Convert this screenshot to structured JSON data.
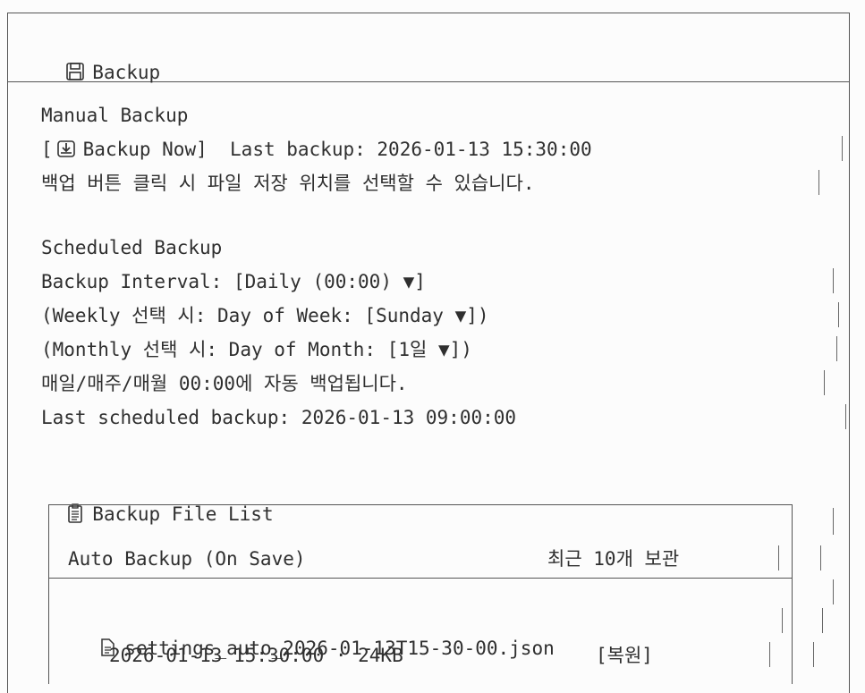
{
  "header": {
    "title": "Backup",
    "icon": "floppy-disk-icon"
  },
  "manual": {
    "heading": "Manual Backup",
    "button_label": "Backup Now",
    "button_icon": "download-tray-icon",
    "last_backup_label": "Last backup:",
    "last_backup_value": "2026-01-13 15:30:00",
    "hint": "백업 버튼 클릭 시 파일 저장 위치를 선택할 수 있습니다."
  },
  "scheduled": {
    "heading": "Scheduled Backup",
    "interval_label": "Backup Interval:",
    "interval_value": "Daily (00:00) ▼",
    "weekly_prefix": "(Weekly 선택 시: Day of Week:",
    "weekly_value": "Sunday ▼",
    "monthly_prefix": "(Monthly 선택 시: Day of Month:",
    "monthly_value": "1일 ▼",
    "hint": "매일/매주/매월 00:00에 자동 백업됩니다.",
    "last_label": "Last scheduled backup:",
    "last_value": "2026-01-13 09:00:00"
  },
  "files": {
    "heading": "Backup File List",
    "icon": "clipboard-icon",
    "section_title": "Auto Backup (On Save)",
    "retention": "최근 10개 보관",
    "items": [
      {
        "name": "settings_auto_2026-01-13T15-30-00.json",
        "meta": "2026-01-13 15:30:00 · 24KB",
        "restore_label": "복원",
        "icon": "file-icon"
      }
    ]
  }
}
